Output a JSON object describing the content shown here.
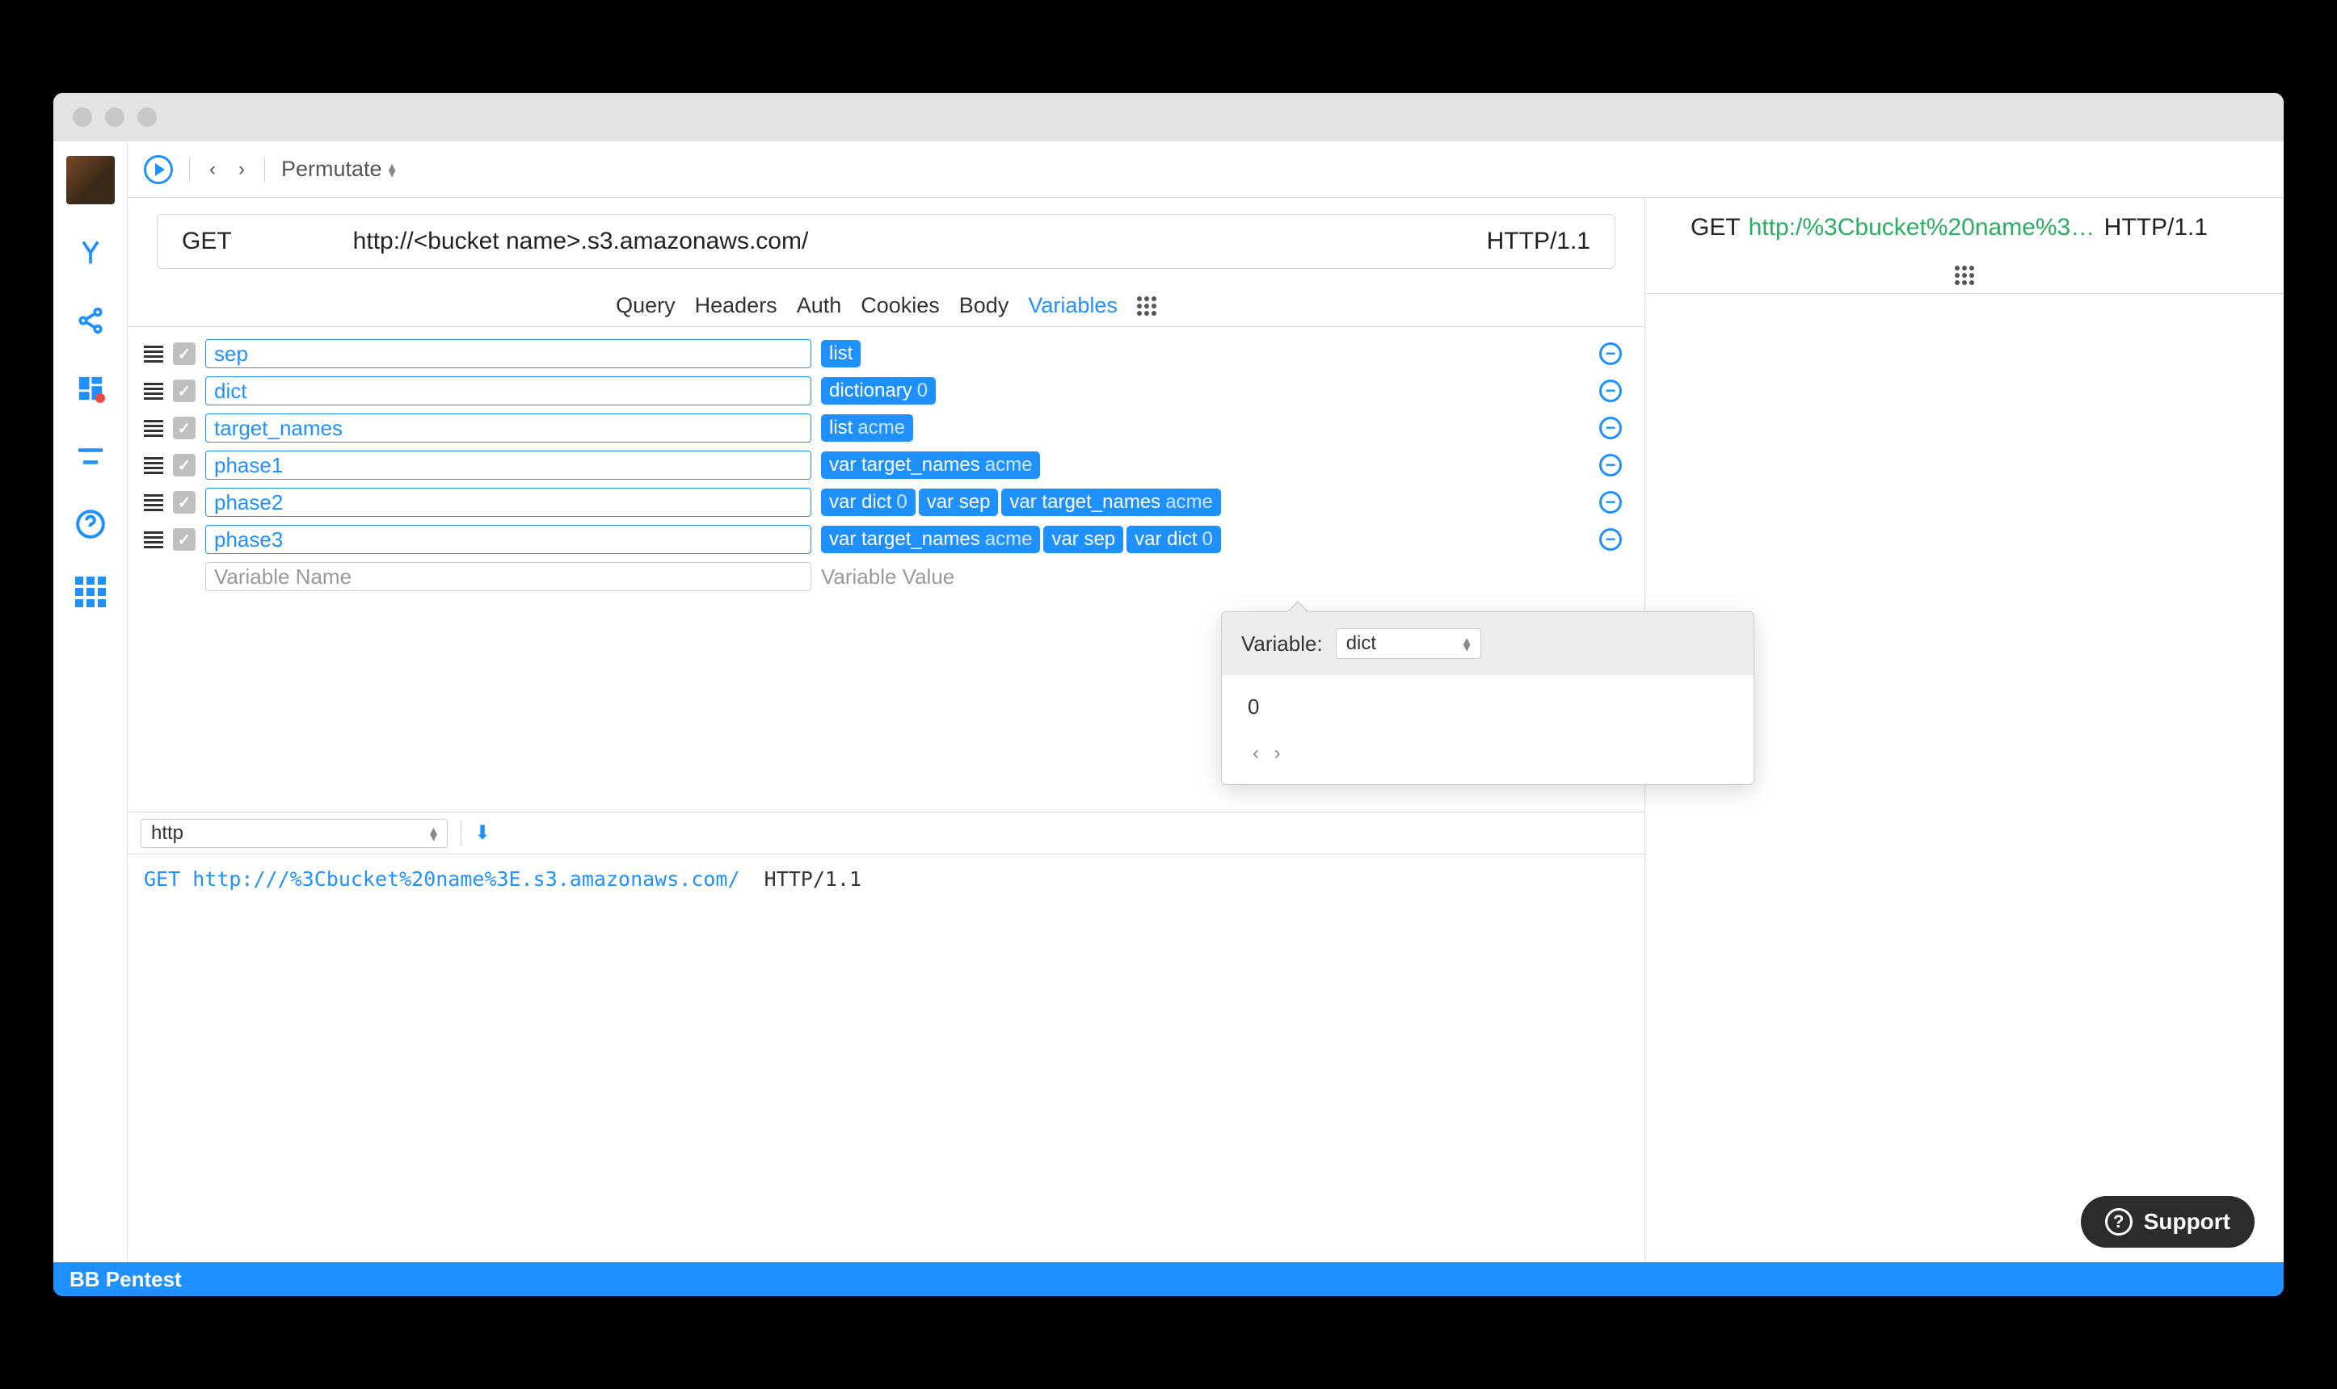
{
  "toolbar": {
    "mode": "Permutate"
  },
  "request": {
    "method": "GET",
    "url": "http://<bucket name>.s3.amazonaws.com/",
    "protocol": "HTTP/1.1",
    "encoded_url": "http:/%3Cbucket%20name%3E…"
  },
  "tabs": [
    "Query",
    "Headers",
    "Auth",
    "Cookies",
    "Body",
    "Variables"
  ],
  "active_tab": "Variables",
  "variables": [
    {
      "name": "sep",
      "value": [
        {
          "k": "list",
          "t": ""
        }
      ]
    },
    {
      "name": "dict",
      "value": [
        {
          "k": "dictionary",
          "t": "0"
        }
      ]
    },
    {
      "name": "target_names",
      "value": [
        {
          "k": "list",
          "t": "acme"
        }
      ]
    },
    {
      "name": "phase1",
      "value": [
        {
          "k": "var target_names",
          "t": "acme"
        }
      ]
    },
    {
      "name": "phase2",
      "value": [
        {
          "k": "var dict",
          "t": "0"
        },
        {
          "k": "var sep",
          "t": ""
        },
        {
          "k": "var target_names",
          "t": "acme"
        }
      ]
    },
    {
      "name": "phase3",
      "value": [
        {
          "k": "var target_names",
          "t": "acme"
        },
        {
          "k": "var sep",
          "t": ""
        },
        {
          "k": "var dict",
          "t": "0"
        }
      ]
    }
  ],
  "new_var_name_ph": "Variable Name",
  "new_var_value_ph": "Variable Value",
  "lower": {
    "scheme": "http",
    "raw_method": "GET",
    "raw_url": "http:///%3Cbucket%20name%3E.s3.amazonaws.com/",
    "raw_proto": "HTTP/1.1"
  },
  "popover": {
    "label": "Variable:",
    "selected": "dict",
    "body": "0"
  },
  "footer": "BB Pentest",
  "support": "Support"
}
